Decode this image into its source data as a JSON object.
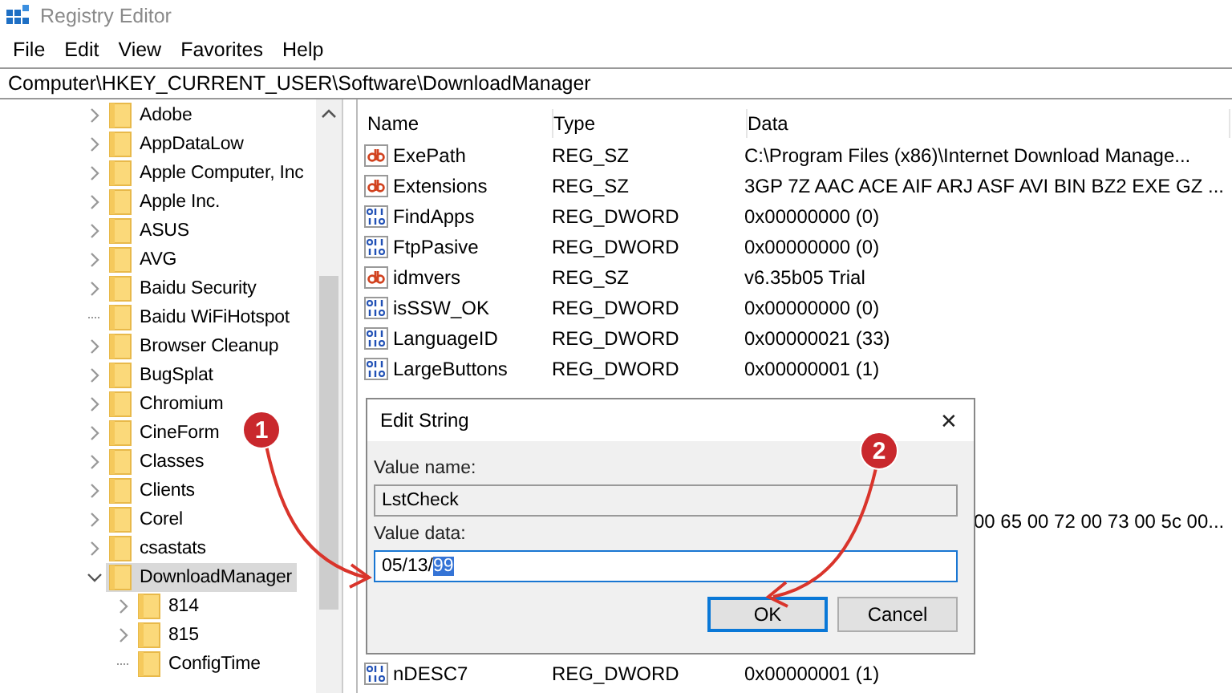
{
  "window": {
    "title": "Registry Editor"
  },
  "menu": [
    "File",
    "Edit",
    "View",
    "Favorites",
    "Help"
  ],
  "address": "Computer\\HKEY_CURRENT_USER\\Software\\DownloadManager",
  "tree": [
    {
      "label": "Adobe",
      "has_children": true,
      "expanded": false,
      "selected": false
    },
    {
      "label": "AppDataLow",
      "has_children": true,
      "expanded": false,
      "selected": false
    },
    {
      "label": "Apple Computer, Inc",
      "has_children": true,
      "expanded": false,
      "selected": false
    },
    {
      "label": "Apple Inc.",
      "has_children": true,
      "expanded": false,
      "selected": false
    },
    {
      "label": "ASUS",
      "has_children": true,
      "expanded": false,
      "selected": false
    },
    {
      "label": "AVG",
      "has_children": true,
      "expanded": false,
      "selected": false
    },
    {
      "label": "Baidu Security",
      "has_children": true,
      "expanded": false,
      "selected": false
    },
    {
      "label": "Baidu WiFiHotspot",
      "has_children": false,
      "selected": false
    },
    {
      "label": "Browser Cleanup",
      "has_children": true,
      "expanded": false,
      "selected": false
    },
    {
      "label": "BugSplat",
      "has_children": true,
      "expanded": false,
      "selected": false
    },
    {
      "label": "Chromium",
      "has_children": true,
      "expanded": false,
      "selected": false
    },
    {
      "label": "CineForm",
      "has_children": true,
      "expanded": false,
      "selected": false
    },
    {
      "label": "Classes",
      "has_children": true,
      "expanded": false,
      "selected": false
    },
    {
      "label": "Clients",
      "has_children": true,
      "expanded": false,
      "selected": false
    },
    {
      "label": "Corel",
      "has_children": true,
      "expanded": false,
      "selected": false
    },
    {
      "label": "csastats",
      "has_children": true,
      "expanded": false,
      "selected": false
    },
    {
      "label": "DownloadManager",
      "has_children": true,
      "expanded": true,
      "selected": true,
      "children": [
        {
          "label": "814",
          "has_children": true,
          "expanded": false,
          "selected": false
        },
        {
          "label": "815",
          "has_children": true,
          "expanded": false,
          "selected": false
        },
        {
          "label": "ConfigTime",
          "has_children": false,
          "selected": false
        }
      ]
    }
  ],
  "list": {
    "columns": [
      "Name",
      "Type",
      "Data"
    ],
    "rows": [
      {
        "kind": "string",
        "name": "ExePath",
        "type": "REG_SZ",
        "data": "C:\\Program Files (x86)\\Internet Download Manage..."
      },
      {
        "kind": "string",
        "name": "Extensions",
        "type": "REG_SZ",
        "data": "3GP 7Z AAC ACE AIF ARJ ASF AVI BIN BZ2 EXE GZ ..."
      },
      {
        "kind": "dword",
        "name": "FindApps",
        "type": "REG_DWORD",
        "data": "0x00000000 (0)"
      },
      {
        "kind": "dword",
        "name": "FtpPasive",
        "type": "REG_DWORD",
        "data": "0x00000000 (0)"
      },
      {
        "kind": "string",
        "name": "idmvers",
        "type": "REG_SZ",
        "data": "v6.35b05 Trial"
      },
      {
        "kind": "dword",
        "name": "isSSW_OK",
        "type": "REG_DWORD",
        "data": "0x00000000 (0)"
      },
      {
        "kind": "dword",
        "name": "LanguageID",
        "type": "REG_DWORD",
        "data": "0x00000021 (33)"
      },
      {
        "kind": "dword",
        "name": "LargeButtons",
        "type": "REG_DWORD",
        "data": "0x00000001 (1)"
      },
      {
        "kind": "covered"
      },
      {
        "kind": "covered"
      },
      {
        "kind": "covered"
      },
      {
        "kind": "covered"
      },
      {
        "kind": "partial",
        "data": "00 65 00 72 00 73 00 5c 00..."
      },
      {
        "kind": "covered"
      },
      {
        "kind": "covered"
      },
      {
        "kind": "covered"
      },
      {
        "kind": "covered"
      },
      {
        "kind": "dword",
        "name": "nDESC7",
        "type": "REG_DWORD",
        "data": "0x00000001 (1)"
      }
    ]
  },
  "dialog": {
    "title": "Edit String",
    "close": "✕",
    "name_label": "Value name:",
    "name_value": "LstCheck",
    "data_label": "Value data:",
    "data_value": "05/13/",
    "data_selection": "99",
    "ok": "OK",
    "cancel": "Cancel"
  },
  "annotations": [
    {
      "label": "1"
    },
    {
      "label": "2"
    }
  ]
}
